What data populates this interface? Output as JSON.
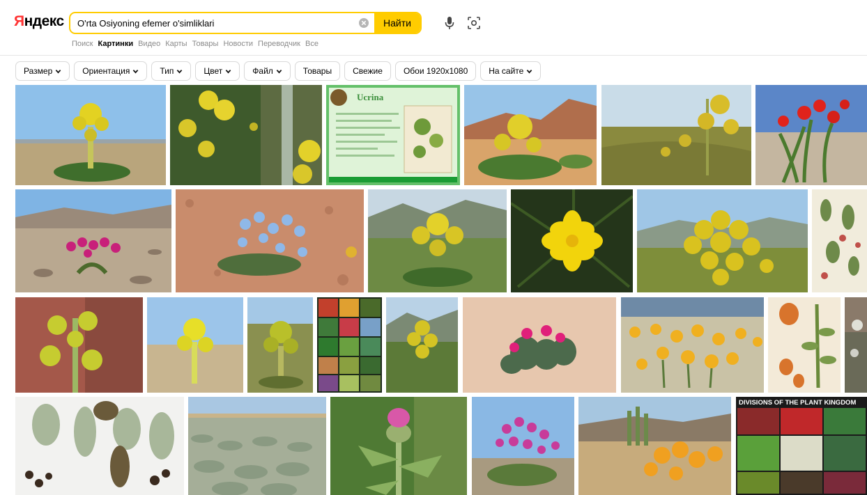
{
  "logo": {
    "text_first": "Я",
    "text_rest": "ндекс"
  },
  "search": {
    "query": "O'rta Osiyoning efemer o'simliklari",
    "button_label": "Найти"
  },
  "nav": [
    {
      "label": "Поиск",
      "active": false
    },
    {
      "label": "Картинки",
      "active": true
    },
    {
      "label": "Видео",
      "active": false
    },
    {
      "label": "Карты",
      "active": false
    },
    {
      "label": "Товары",
      "active": false
    },
    {
      "label": "Новости",
      "active": false
    },
    {
      "label": "Переводчик",
      "active": false
    },
    {
      "label": "Все",
      "active": false
    }
  ],
  "filters": [
    {
      "label": "Размер",
      "dropdown": true
    },
    {
      "label": "Ориентация",
      "dropdown": true
    },
    {
      "label": "Тип",
      "dropdown": true
    },
    {
      "label": "Цвет",
      "dropdown": true
    },
    {
      "label": "Файл",
      "dropdown": true
    },
    {
      "label": "Товары",
      "dropdown": false
    },
    {
      "label": "Свежие",
      "dropdown": false
    },
    {
      "label": "Обои 1920x1080",
      "dropdown": false
    },
    {
      "label": "На сайте",
      "dropdown": true
    }
  ],
  "images": {
    "tile_texts": {
      "r1_3": "Ucrina",
      "r4_6": "DIVISIONS OF THE PLANT KINGDOM"
    },
    "colors": {
      "yellow_flower": "#e8d21c",
      "red_flower": "#e0231c",
      "magenta_flower": "#c8207a",
      "blue_flower": "#8fb8e8",
      "sky": "#8ec0ea",
      "ground": "#c8a878",
      "green": "#3c7a2c"
    }
  },
  "colors": {
    "accent": "#ffcc00",
    "logo_red": "#ff3333",
    "nav_inactive": "#8a8a8a",
    "filter_border": "#d8d8d8"
  }
}
